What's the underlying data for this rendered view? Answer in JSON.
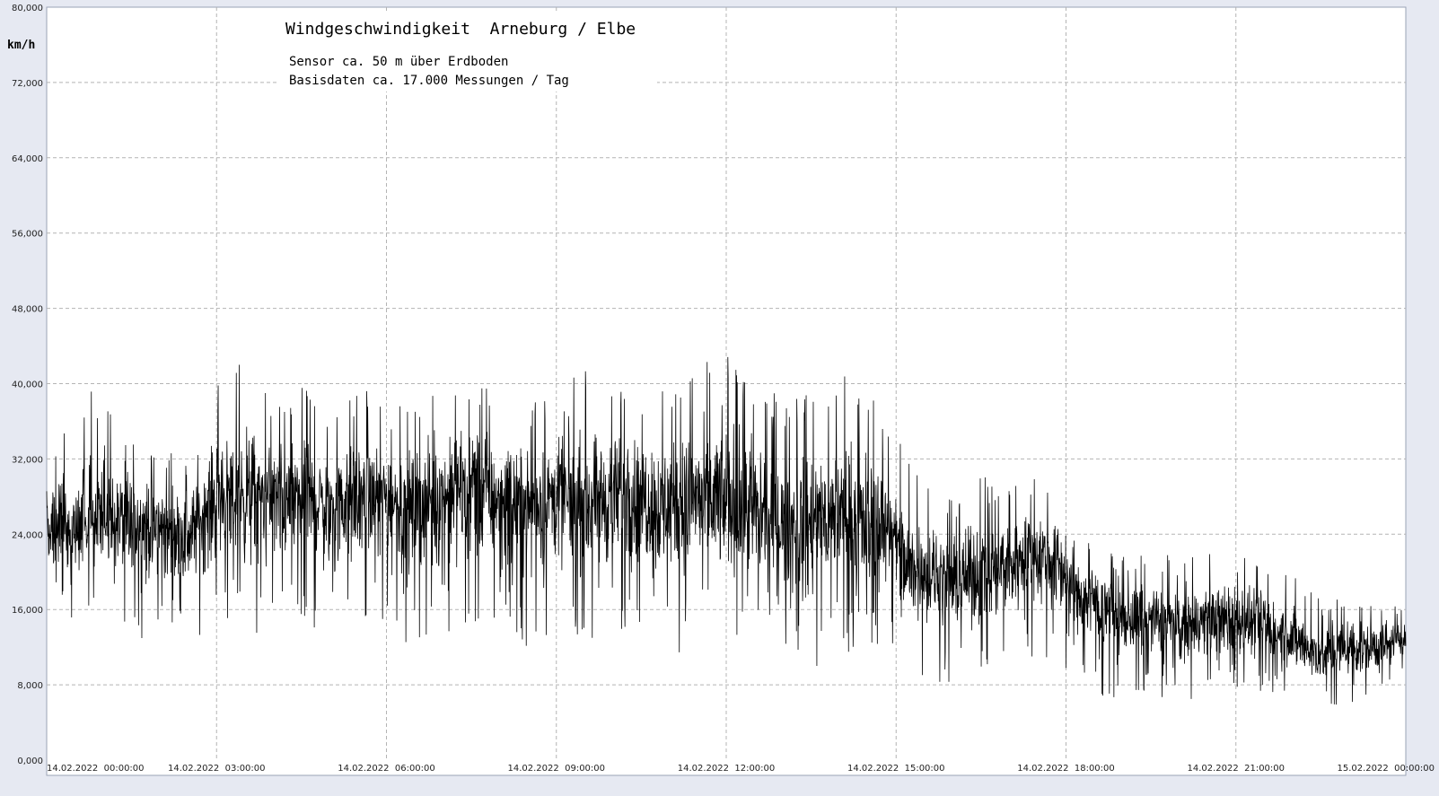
{
  "chart_data": {
    "type": "line",
    "title": "Windgeschwindigkeit  Arneburg / Elbe",
    "subtitle_lines": [
      "Sensor ca. 50 m über Erdboden",
      "Basisdaten ca. 17.000 Messungen / Tag"
    ],
    "ylabel": "km/h",
    "xlabel": "",
    "ylim": [
      0,
      80
    ],
    "xlim_hours": [
      0,
      24
    ],
    "grid": true,
    "y_ticks": [
      {
        "value": 0,
        "label": "0,000"
      },
      {
        "value": 8,
        "label": "8,000"
      },
      {
        "value": 16,
        "label": "16,000"
      },
      {
        "value": 24,
        "label": "24,000"
      },
      {
        "value": 32,
        "label": "32,000"
      },
      {
        "value": 40,
        "label": "40,000"
      },
      {
        "value": 48,
        "label": "48,000"
      },
      {
        "value": 56,
        "label": "56,000"
      },
      {
        "value": 64,
        "label": "64,000"
      },
      {
        "value": 72,
        "label": "72,000"
      },
      {
        "value": 80,
        "label": "80,000"
      }
    ],
    "x_ticks": [
      {
        "hour": 0,
        "label": "14.02.2022  00:00:00"
      },
      {
        "hour": 3,
        "label": "14.02.2022  03:00:00"
      },
      {
        "hour": 6,
        "label": "14.02.2022  06:00:00"
      },
      {
        "hour": 9,
        "label": "14.02.2022  09:00:00"
      },
      {
        "hour": 12,
        "label": "14.02.2022  12:00:00"
      },
      {
        "hour": 15,
        "label": "14.02.2022  15:00:00"
      },
      {
        "hour": 18,
        "label": "14.02.2022  18:00:00"
      },
      {
        "hour": 21,
        "label": "14.02.2022  21:00:00"
      },
      {
        "hour": 24,
        "label": "15.02.2022  00:00:00"
      }
    ],
    "series": [
      {
        "color": "#000000",
        "envelope_hourly": {
          "hour": [
            0,
            0.5,
            1,
            1.5,
            2,
            2.5,
            3,
            3.5,
            4,
            4.5,
            5,
            5.5,
            6,
            6.5,
            7,
            7.5,
            8,
            8.5,
            9,
            9.5,
            10,
            10.5,
            11,
            11.5,
            12,
            12.5,
            13,
            13.5,
            14,
            14.5,
            14.9,
            15.1,
            15.5,
            16,
            16.5,
            17,
            17.5,
            17.9,
            18.1,
            18.5,
            19,
            19.5,
            20,
            20.5,
            21,
            21.5,
            22,
            22.5,
            23,
            23.5,
            24
          ],
          "mean": [
            24,
            25,
            26,
            25,
            25,
            24,
            28,
            28,
            28,
            28,
            27,
            28,
            28,
            27,
            28,
            29,
            28,
            27,
            28,
            27,
            28,
            28,
            27,
            28,
            27,
            26,
            25,
            25,
            26,
            25,
            25,
            20,
            20,
            19,
            20,
            21,
            22,
            21,
            18,
            17,
            15,
            15,
            14,
            15,
            15,
            14,
            13,
            11,
            12,
            12,
            13
          ],
          "low": [
            16,
            15,
            14,
            13,
            12,
            12,
            15,
            14,
            12,
            14,
            13,
            14,
            13,
            12,
            12,
            13,
            14,
            12,
            13,
            12,
            13,
            14,
            11,
            12,
            14,
            12,
            11,
            9,
            12,
            10,
            11,
            8,
            8,
            8,
            9,
            10,
            11,
            10,
            8,
            7,
            6,
            6,
            6,
            7,
            7,
            7,
            6,
            5,
            6,
            6,
            10
          ],
          "high": [
            34,
            38,
            40,
            36,
            34,
            32,
            40,
            43,
            38,
            40,
            36,
            40,
            38,
            38,
            40,
            42,
            40,
            38,
            39,
            42,
            40,
            42,
            39,
            42,
            45,
            42,
            38,
            40,
            42,
            40,
            36,
            34,
            30,
            28,
            30,
            31,
            30,
            29,
            24,
            23,
            22,
            22,
            22,
            22,
            22,
            21,
            20,
            17,
            18,
            18,
            16
          ]
        }
      }
    ]
  }
}
